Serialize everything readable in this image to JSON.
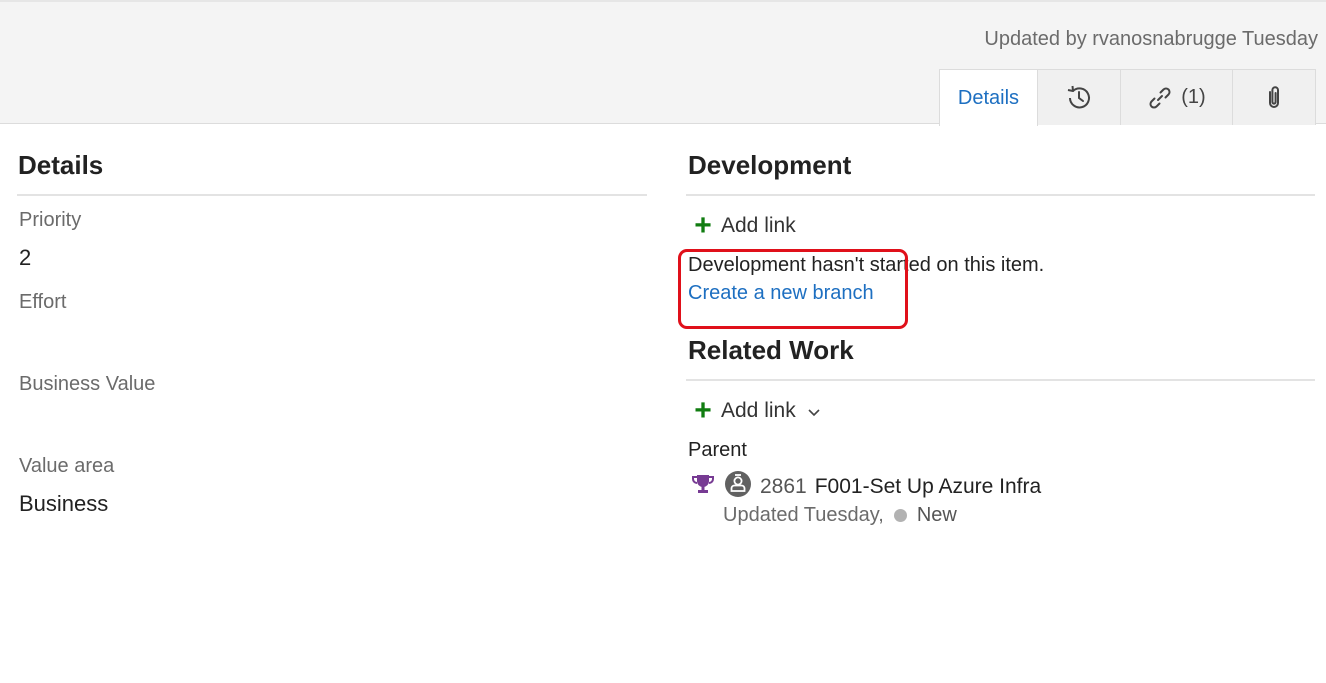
{
  "header": {
    "updated_text": "Updated by rvanosnabrugge Tuesday"
  },
  "tabs": [
    {
      "label": "Details",
      "active": true
    },
    {
      "icon": "history-icon"
    },
    {
      "icon": "link-icon",
      "label": "(1)"
    },
    {
      "icon": "paperclip-icon"
    }
  ],
  "details": {
    "title": "Details",
    "fields": [
      {
        "label": "Priority",
        "value": "2"
      },
      {
        "label": "Effort",
        "value": ""
      },
      {
        "label": "Business Value",
        "value": ""
      },
      {
        "label": "Value area",
        "value": "Business"
      }
    ]
  },
  "development": {
    "title": "Development",
    "add_link_label": "Add link",
    "status_text": "Development hasn't started on this item.",
    "create_branch_label": "Create a new branch"
  },
  "related_work": {
    "title": "Related Work",
    "add_link_label": "Add link",
    "parent_label": "Parent",
    "parent": {
      "id": "2861",
      "title": "F001-Set Up Azure Infra",
      "updated": "Updated Tuesday,",
      "state": "New"
    }
  },
  "colors": {
    "accent": "#1d6fc1",
    "add_green": "#107c10",
    "highlight_red": "#e0101a",
    "trophy_purple": "#773b93",
    "state_gray": "#b2b2b2"
  }
}
